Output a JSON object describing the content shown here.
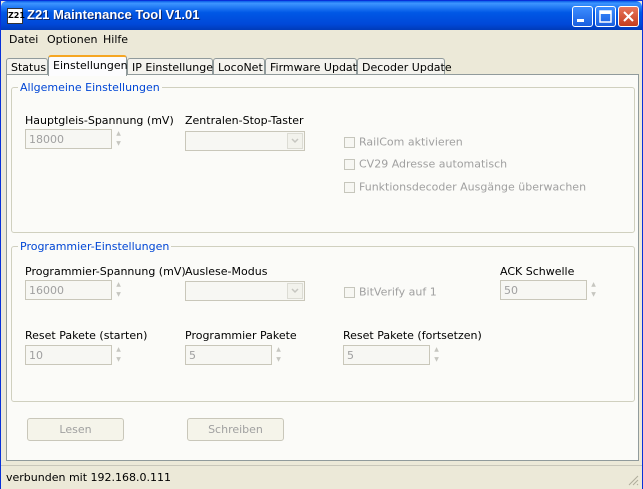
{
  "window": {
    "title": "Z21 Maintenance Tool V1.01",
    "icon_text": "Z21"
  },
  "menu": [
    {
      "label": "Datei"
    },
    {
      "label": "Optionen"
    },
    {
      "label": "Hilfe"
    }
  ],
  "tabs": [
    {
      "label": "Status",
      "active": false
    },
    {
      "label": "Einstellungen",
      "active": true
    },
    {
      "label": "IP Einstellungen",
      "active": false
    },
    {
      "label": "LocoNet",
      "active": false
    },
    {
      "label": "Firmware Update",
      "active": false
    },
    {
      "label": "Decoder Update",
      "active": false
    }
  ],
  "general": {
    "title": "Allgemeine Einstellungen",
    "track_voltage_label": "Hauptgleis-Spannung (mV)",
    "track_voltage_value": "18000",
    "stop_button_label": "Zentralen-Stop-Taster",
    "stop_button_value": "",
    "railcom_label": "RailCom aktivieren",
    "cv29_label": "CV29 Adresse automatisch",
    "func_decoder_label": "Funktionsdecoder Ausgänge überwachen"
  },
  "programming": {
    "title": "Programmier-Einstellungen",
    "prog_voltage_label": "Programmier-Spannung (mV)",
    "prog_voltage_value": "16000",
    "read_mode_label": "Auslese-Modus",
    "read_mode_value": "",
    "bitverify_label": "BitVerify auf 1",
    "ack_label": "ACK Schwelle",
    "ack_value": "50",
    "reset_start_label": "Reset Pakete (starten)",
    "reset_start_value": "10",
    "prog_packets_label": "Programmier Pakete",
    "prog_packets_value": "5",
    "reset_continue_label": "Reset Pakete (fortsetzen)",
    "reset_continue_value": "5"
  },
  "buttons": {
    "read": "Lesen",
    "write": "Schreiben"
  },
  "status": {
    "text": "verbunden mit 192.168.0.111"
  },
  "colors": {
    "title_blue": "#0058e6",
    "group_title": "#0046d5",
    "tab_highlight": "#f5a623"
  }
}
